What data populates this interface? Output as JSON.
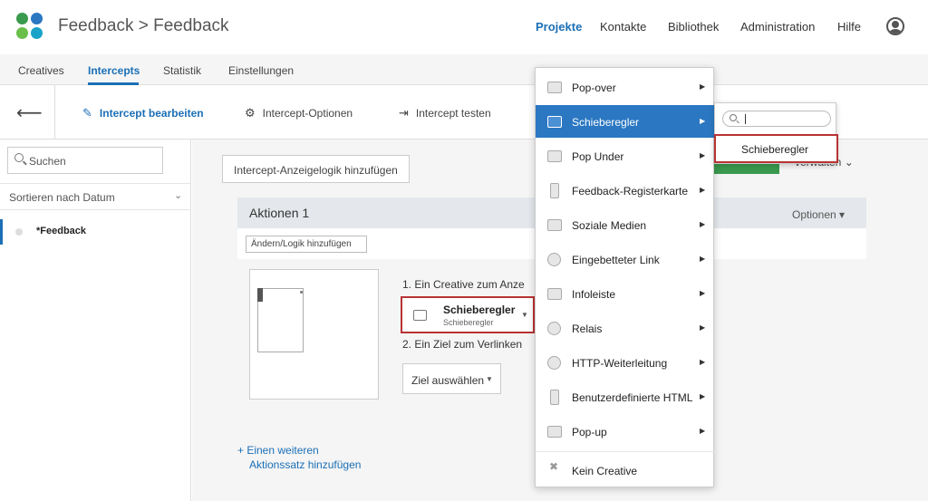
{
  "header": {
    "app_title": "Feedback > Feedback",
    "nav": [
      "Projekte",
      "Kontakte",
      "Bibliothek",
      "Administration",
      "Hilfe"
    ],
    "active_nav": "Projekte",
    "logo_colors": [
      "#3a9a4e",
      "#2b77c2",
      "#6abf4b",
      "#1aa3c9"
    ]
  },
  "subtabs": [
    "Creatives",
    "Intercepts",
    "Statistik",
    "Einstellungen"
  ],
  "toolbar": {
    "back_icon": "arrow-left-icon",
    "edit": "Intercept bearbeiten",
    "options": "Intercept-Optionen",
    "test": "Intercept testen"
  },
  "sidebar": {
    "search_placeholder": "Suchen",
    "sort_label": "Sortieren nach Datum",
    "items": [
      "*Feedback"
    ]
  },
  "main": {
    "logic_button": "Intercept-Anzeigelogik hinzufügen",
    "verwalten": "verwalten",
    "action": {
      "title": "Aktionen 1",
      "options": "Optionen",
      "change_logic": "Ändern/Logik hinzufügen",
      "step1": "1. Ein Creative zum Anze",
      "creative_name": "Schieberegler",
      "creative_sub": "Schieberegler",
      "step2": "2. Ein Ziel zum Verlinken",
      "target_button": "Ziel auswählen"
    },
    "add_link_line1": "+ Einen weiteren",
    "add_link_line2": "Aktionssatz hinzufügen"
  },
  "menu": {
    "items": [
      {
        "label": "Pop-over",
        "icon": "popover-icon"
      },
      {
        "label": "Schieberegler",
        "icon": "slider-icon"
      },
      {
        "label": "Pop Under",
        "icon": "popunder-icon"
      },
      {
        "label": "Feedback-Registerkarte",
        "icon": "feedback-tab-icon"
      },
      {
        "label": "Soziale Medien",
        "icon": "social-media-icon"
      },
      {
        "label": "Eingebetteter Link",
        "icon": "link-icon"
      },
      {
        "label": "Infoleiste",
        "icon": "infobar-icon"
      },
      {
        "label": "Relais",
        "icon": "relay-icon"
      },
      {
        "label": "HTTP-Weiterleitung",
        "icon": "redirect-icon"
      },
      {
        "label": "Benutzerdefinierte HTML",
        "icon": "html-icon"
      },
      {
        "label": "Pop-up",
        "icon": "popup-icon"
      }
    ],
    "none_label": "Kein Creative",
    "selected": "Schieberegler"
  },
  "submenu": {
    "search_value": "",
    "item": "Schieberegler"
  }
}
